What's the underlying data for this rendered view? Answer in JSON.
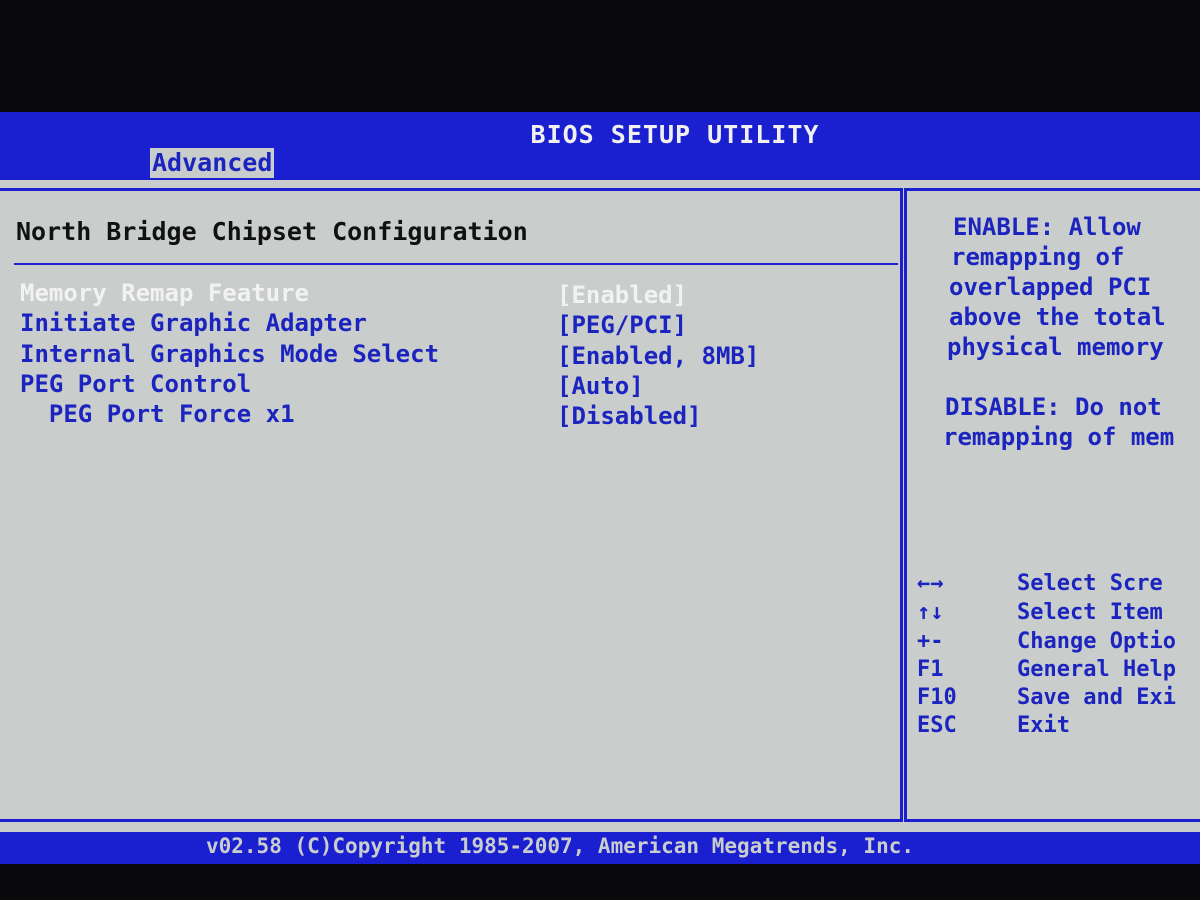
{
  "title": "BIOS SETUP UTILITY",
  "tab": "Advanced",
  "heading": "North Bridge Chipset Configuration",
  "items": [
    {
      "label": "Memory Remap Feature",
      "value": "[Enabled]"
    },
    {
      "label": "Initiate Graphic Adapter",
      "value": "[PEG/PCI]"
    },
    {
      "label": "Internal Graphics Mode Select",
      "value": "[Enabled, 8MB]"
    },
    {
      "label": "PEG Port Control",
      "value": "[Auto]"
    },
    {
      "label": "  PEG Port Force x1",
      "value": "[Disabled]"
    }
  ],
  "help": [
    "ENABLE: Allow",
    "remapping of",
    "overlapped PCI",
    "above the total",
    "physical memory",
    "",
    "DISABLE: Do not",
    "remapping of mem"
  ],
  "keys": [
    {
      "key": "←→",
      "desc": "Select Scre"
    },
    {
      "key": "↑↓",
      "desc": "Select Item"
    },
    {
      "key": "+-",
      "desc": "Change Optio"
    },
    {
      "key": "F1",
      "desc": "General Help"
    },
    {
      "key": "F10",
      "desc": "Save and Exi"
    },
    {
      "key": "ESC",
      "desc": "Exit"
    }
  ],
  "footer": "v02.58 (C)Copyright 1985-2007, American Megatrends, Inc."
}
